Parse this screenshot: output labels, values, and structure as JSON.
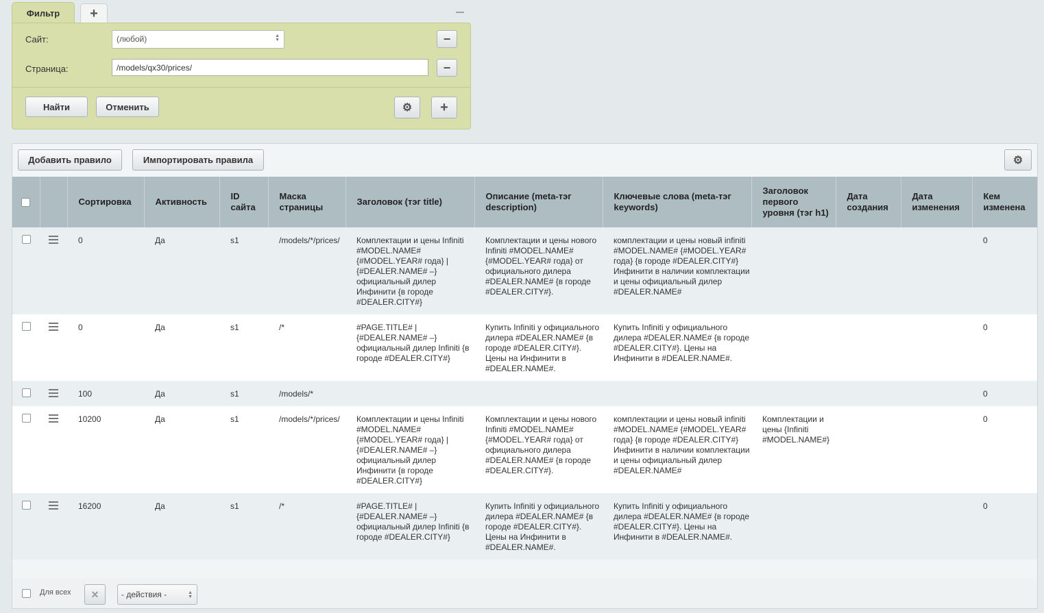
{
  "filter": {
    "tab_label": "Фильтр",
    "tab_add_icon": "plus-icon",
    "site_label": "Сайт:",
    "site_value": "(любой)",
    "page_label": "Страница:",
    "page_value": "/models/qx30/prices/",
    "find_label": "Найти",
    "cancel_label": "Отменить",
    "remove_symbol": "−",
    "add_symbol": "+",
    "gear_symbol": "⚙"
  },
  "toolbar": {
    "add_rule_label": "Добавить правило",
    "import_rules_label": "Импортировать правила",
    "settings_icon": "gear-icon",
    "gear_symbol": "⚙"
  },
  "columns": [
    "Сортировка",
    "Активность",
    "ID сайта",
    "Маска страницы",
    "Заголовок (тэг title)",
    "Описание (meta-тэг description)",
    "Ключевые слова (meta-тэг keywords)",
    "Заголовок первого уровня (тэг h1)",
    "Дата создания",
    "Дата изменения",
    "Кем изменена"
  ],
  "rows": [
    {
      "sort": "0",
      "active": "Да",
      "site_id": "s1",
      "mask": "/models/*/prices/",
      "title": "Комплектации и цены Infiniti #MODEL.NAME# {#MODEL.YEAR# года} | {#DEALER.NAME# –} официальный дилер Инфинити {в городе #DEALER.CITY#}",
      "description": "Комплектации и цены нового Infiniti #MODEL.NAME# {#MODEL.YEAR# года} от официального дилера #DEALER.NAME# {в городе #DEALER.CITY#}.",
      "keywords": "комплектации и цены новый infiniti #MODEL.NAME# {#MODEL.YEAR# года} {в городе #DEALER.CITY#} Инфинити в наличии комплектации и цены официальный дилер #DEALER.NAME#",
      "h1": "",
      "created": "",
      "modified": "",
      "modified_by": "0"
    },
    {
      "sort": "0",
      "active": "Да",
      "site_id": "s1",
      "mask": "/*",
      "title": "#PAGE.TITLE# | {#DEALER.NAME# –} официальный дилер Infiniti {в городе #DEALER.CITY#}",
      "description": "Купить Infiniti у официального дилера #DEALER.NAME# {в городе #DEALER.CITY#}. Цены на Инфинити в #DEALER.NAME#.",
      "keywords": "Купить Infiniti у официального дилера #DEALER.NAME# {в городе #DEALER.CITY#}. Цены на Инфинити в #DEALER.NAME#.",
      "h1": "",
      "created": "",
      "modified": "",
      "modified_by": "0"
    },
    {
      "sort": "100",
      "active": "Да",
      "site_id": "s1",
      "mask": "/models/*",
      "title": "",
      "description": "",
      "keywords": "",
      "h1": "",
      "created": "",
      "modified": "",
      "modified_by": "0"
    },
    {
      "sort": "10200",
      "active": "Да",
      "site_id": "s1",
      "mask": "/models/*/prices/",
      "title": "Комплектации и цены Infiniti #MODEL.NAME# {#MODEL.YEAR# года} | {#DEALER.NAME# –} официальный дилер Инфинити {в городе #DEALER.CITY#}",
      "description": "Комплектации и цены нового Infiniti #MODEL.NAME# {#MODEL.YEAR# года} от официального дилера #DEALER.NAME# {в городе #DEALER.CITY#}.",
      "keywords": "комплектации и цены новый infiniti #MODEL.NAME# {#MODEL.YEAR# года} {в городе #DEALER.CITY#} Инфинити в наличии комплектации и цены официальный дилер #DEALER.NAME#",
      "h1": "Комплектации и цены {Infiniti #MODEL.NAME#}",
      "created": "",
      "modified": "",
      "modified_by": "0"
    },
    {
      "sort": "16200",
      "active": "Да",
      "site_id": "s1",
      "mask": "/*",
      "title": "#PAGE.TITLE# | {#DEALER.NAME# –} официальный дилер Infiniti {в городе #DEALER.CITY#}",
      "description": "Купить Infiniti у официального дилера #DEALER.NAME# {в городе #DEALER.CITY#}. Цены на Инфинити в #DEALER.NAME#.",
      "keywords": "Купить Infiniti у официального дилера #DEALER.NAME# {в городе #DEALER.CITY#}. Цены на Инфинити в #DEALER.NAME#.",
      "h1": "",
      "created": "",
      "modified": "",
      "modified_by": "0"
    }
  ],
  "footer": {
    "for_all_label": "Для всех",
    "clear_symbol": "✕",
    "actions_value": "- действия -"
  },
  "colors": {
    "filter_bg": "#d8dfab",
    "header_bg": "#aebdc2",
    "row_alt_bg": "#eaf0f2"
  }
}
